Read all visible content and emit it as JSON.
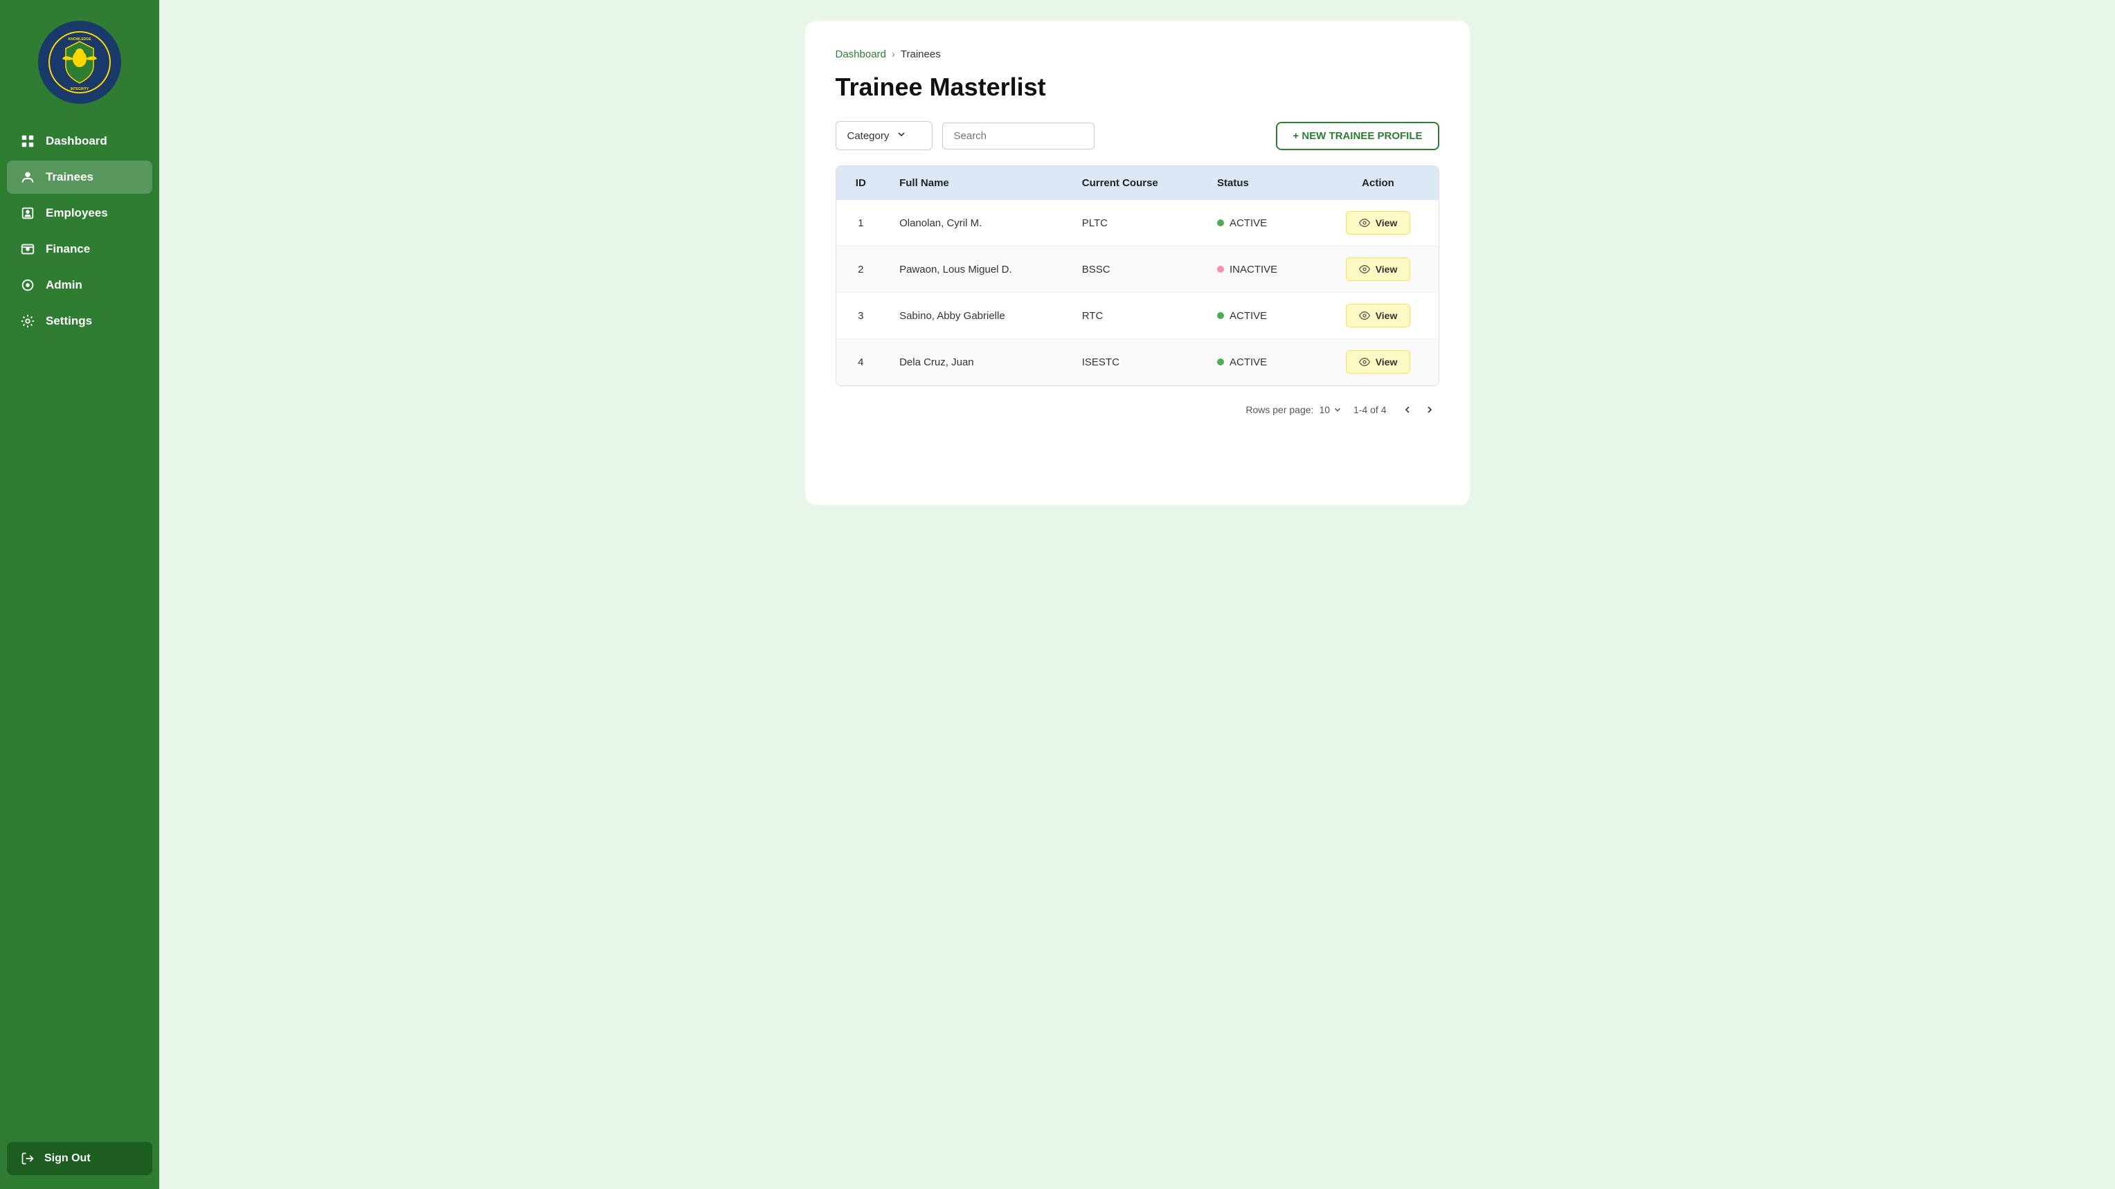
{
  "sidebar": {
    "nav_items": [
      {
        "id": "dashboard",
        "label": "Dashboard",
        "icon": "grid-icon",
        "active": false
      },
      {
        "id": "trainees",
        "label": "Trainees",
        "icon": "user-icon",
        "active": true
      },
      {
        "id": "employees",
        "label": "Employees",
        "icon": "employee-icon",
        "active": false
      },
      {
        "id": "finance",
        "label": "Finance",
        "icon": "finance-icon",
        "active": false
      },
      {
        "id": "admin",
        "label": "Admin",
        "icon": "admin-icon",
        "active": false
      },
      {
        "id": "settings",
        "label": "Settings",
        "icon": "settings-icon",
        "active": false
      }
    ],
    "signout_label": "Sign Out"
  },
  "breadcrumb": {
    "link_label": "Dashboard",
    "separator": ">",
    "current": "Trainees"
  },
  "page": {
    "title": "Trainee Masterlist",
    "category_placeholder": "Category",
    "search_placeholder": "Search",
    "new_trainee_btn": "+ NEW TRAINEE PROFILE"
  },
  "table": {
    "headers": [
      "ID",
      "Full Name",
      "Current Course",
      "Status",
      "Action"
    ],
    "rows": [
      {
        "id": 1,
        "full_name": "Olanolan, Cyril M.",
        "current_course": "PLTC",
        "status": "ACTIVE",
        "status_type": "active"
      },
      {
        "id": 2,
        "full_name": "Pawaon, Lous Miguel D.",
        "current_course": "BSSC",
        "status": "INACTIVE",
        "status_type": "inactive"
      },
      {
        "id": 3,
        "full_name": "Sabino, Abby Gabrielle",
        "current_course": "RTC",
        "status": "ACTIVE",
        "status_type": "active"
      },
      {
        "id": 4,
        "full_name": "Dela Cruz, Juan",
        "current_course": "ISESTC",
        "status": "ACTIVE",
        "status_type": "active"
      }
    ],
    "view_btn_label": "View"
  },
  "pagination": {
    "rows_per_page_label": "Rows per page:",
    "rows_per_page_value": "10",
    "page_info": "1-4 of 4"
  }
}
